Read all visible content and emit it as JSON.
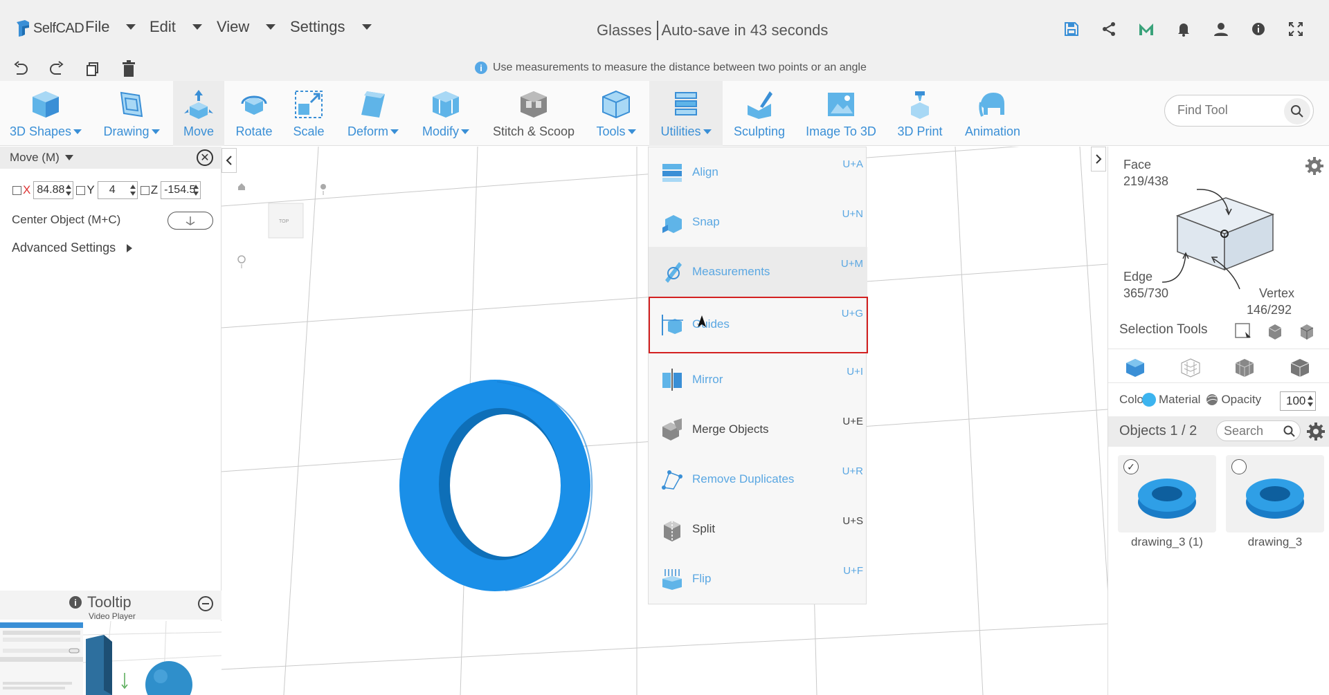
{
  "app": {
    "logo_text": "SelfCAD"
  },
  "menu": [
    "File",
    "Edit",
    "View",
    "Settings"
  ],
  "document": {
    "title": "Glasses",
    "autosave": "Auto-save in 43 seconds"
  },
  "hint": "Use measurements to measure the distance between two points or an angle",
  "toolbar": [
    {
      "label": "3D Shapes",
      "dropdown": true
    },
    {
      "label": "Drawing",
      "dropdown": true
    },
    {
      "label": "Move",
      "dropdown": false
    },
    {
      "label": "Rotate",
      "dropdown": false
    },
    {
      "label": "Scale",
      "dropdown": false
    },
    {
      "label": "Deform",
      "dropdown": true
    },
    {
      "label": "Modify",
      "dropdown": true
    },
    {
      "label": "Stitch & Scoop",
      "dropdown": false
    },
    {
      "label": "Tools",
      "dropdown": true
    },
    {
      "label": "Utilities",
      "dropdown": true
    },
    {
      "label": "Sculpting",
      "dropdown": false
    },
    {
      "label": "Image To 3D",
      "dropdown": false
    },
    {
      "label": "3D Print",
      "dropdown": false
    },
    {
      "label": "Animation",
      "dropdown": false
    }
  ],
  "find_tool": {
    "placeholder": "Find Tool"
  },
  "left_panel": {
    "title": "Move (M)",
    "x_label": "X",
    "x_value": "84.88",
    "y_label": "Y",
    "y_value": "4",
    "z_label": "Z",
    "z_value": "-154.5",
    "center_object": "Center Object (M+C)",
    "advanced": "Advanced Settings"
  },
  "tooltip": {
    "title": "Tooltip",
    "subtitle": "Video Player"
  },
  "viewport": {
    "cube_face": "TOP"
  },
  "utilities_menu": [
    {
      "label": "Align",
      "shortcut": "U+A",
      "active": true
    },
    {
      "label": "Snap",
      "shortcut": "U+N",
      "active": true
    },
    {
      "label": "Measurements",
      "shortcut": "U+M",
      "active": true
    },
    {
      "label": "Guides",
      "shortcut": "U+G",
      "active": true
    },
    {
      "label": "Mirror",
      "shortcut": "U+I",
      "active": true
    },
    {
      "label": "Merge Objects",
      "shortcut": "U+E",
      "active": false
    },
    {
      "label": "Remove Duplicates",
      "shortcut": "U+R",
      "active": true
    },
    {
      "label": "Split",
      "shortcut": "U+S",
      "active": false
    },
    {
      "label": "Flip",
      "shortcut": "U+F",
      "active": true
    }
  ],
  "right_panel": {
    "face_label": "Face",
    "face_count": "219/438",
    "edge_label": "Edge",
    "edge_count": "365/730",
    "vertex_label": "Vertex",
    "vertex_count": "146/292",
    "selection_tools": "Selection Tools",
    "color": "Colo",
    "material": "Material",
    "opacity": "Opacity",
    "opacity_value": "100",
    "objects_title": "Objects 1 / 2",
    "search_placeholder": "Search",
    "objects": [
      {
        "name": "drawing_3 (1)",
        "checked": true
      },
      {
        "name": "drawing_3",
        "checked": false
      }
    ]
  },
  "colors": {
    "accent": "#3a8fd6",
    "object": "#1a8fe8",
    "highlight": "#d32020"
  }
}
